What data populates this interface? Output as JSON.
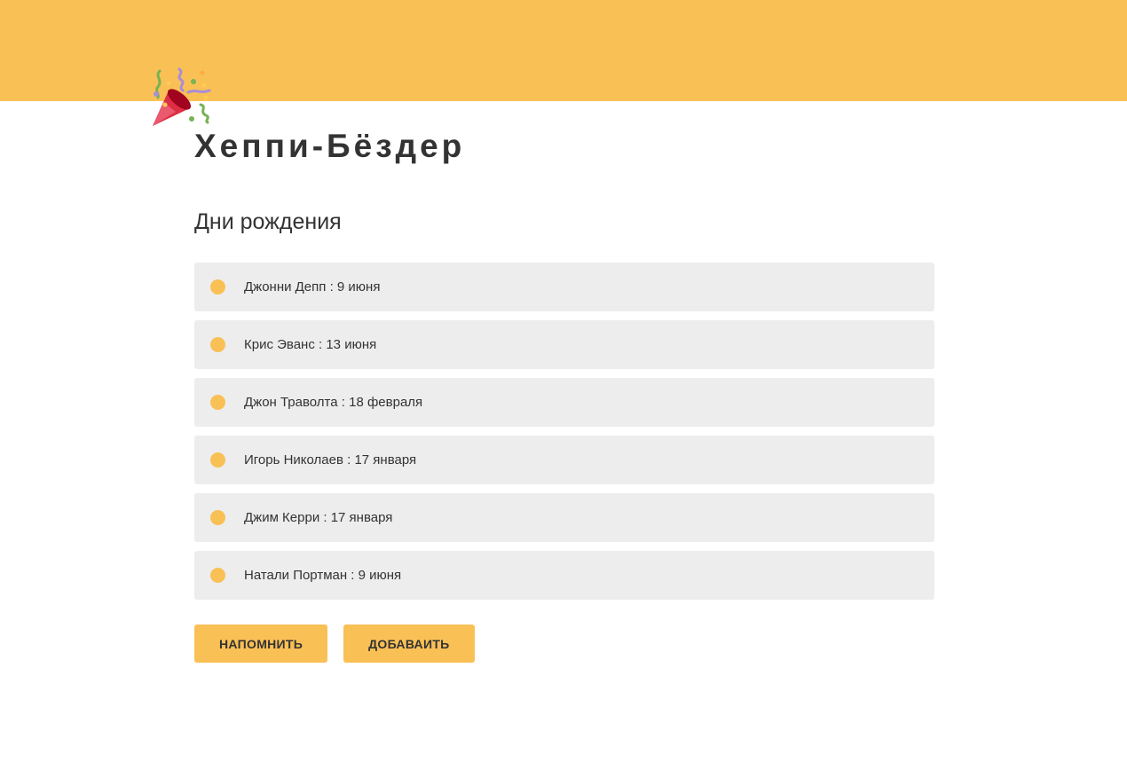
{
  "header": {
    "icon": "party-popper-icon",
    "site_title": "Хеппи-Бёздер"
  },
  "main": {
    "heading": "Дни рождения",
    "birthdays": [
      {
        "text": "Джонни Депп : 9 июня"
      },
      {
        "text": "Крис Эванс : 13 июня"
      },
      {
        "text": "Джон Траволта : 18 февраля"
      },
      {
        "text": "Игорь Николаев : 17 января"
      },
      {
        "text": "Джим Керри : 17 января"
      },
      {
        "text": "Натали Портман : 9 июня"
      }
    ],
    "buttons": {
      "remind_label": "НАПОМНИТЬ",
      "add_label": "ДОБАВАИТЬ"
    }
  },
  "colors": {
    "accent": "#f9c055",
    "item_background": "#ededed",
    "text": "#333333"
  }
}
